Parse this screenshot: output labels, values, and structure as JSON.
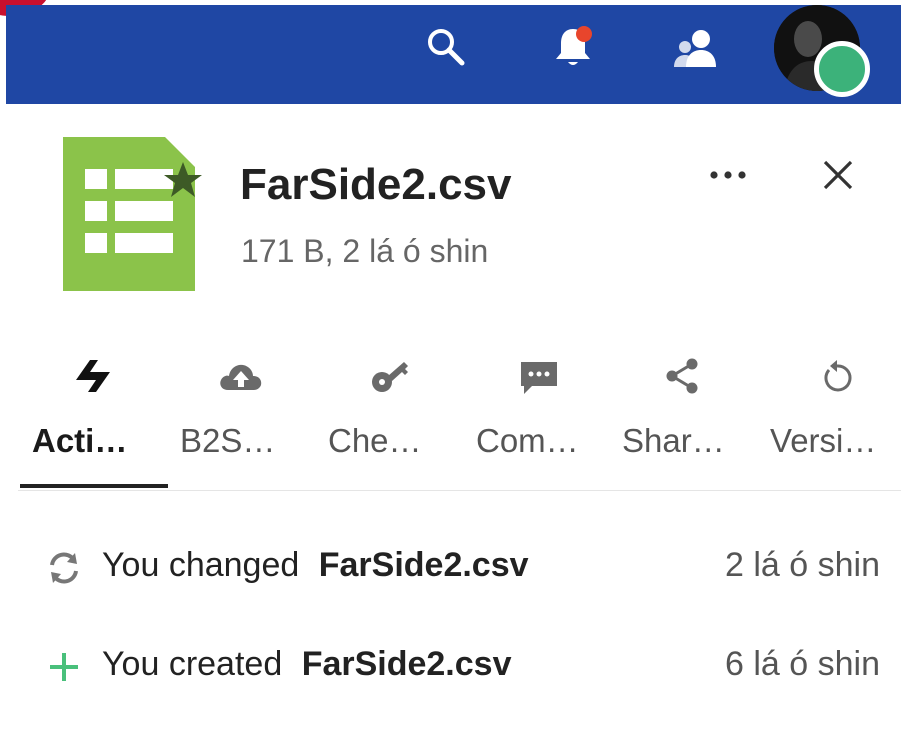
{
  "header": {
    "icons": [
      "search-icon",
      "notifications-icon",
      "contacts-icon"
    ],
    "avatar_status_color": "#3cb27a",
    "bar_color": "#1f47a4"
  },
  "sidebar": {
    "file": {
      "name": "FarSide2.csv",
      "meta": "171 B, 2 lá ó shin",
      "icon": "spreadsheet-icon",
      "icon_color": "#8bc34a",
      "favorite": true
    },
    "actions": {
      "more_label": "•••",
      "close_label": "✕"
    },
    "tabs": [
      {
        "label": "Acti…",
        "icon": "activity-icon",
        "active": true
      },
      {
        "label": "B2S…",
        "icon": "cloud-upload-icon",
        "active": false
      },
      {
        "label": "Che…",
        "icon": "key-icon",
        "active": false
      },
      {
        "label": "Com…",
        "icon": "comment-icon",
        "active": false
      },
      {
        "label": "Shar…",
        "icon": "share-icon",
        "active": false
      },
      {
        "label": "Versi…",
        "icon": "history-icon",
        "active": false
      }
    ],
    "activities": [
      {
        "prefix": "You changed",
        "file": "FarSide2.csv",
        "time": "2 lá ó shin",
        "icon": "change-icon"
      },
      {
        "prefix": "You created",
        "file": "FarSide2.csv",
        "time": "6 lá ó shin",
        "icon": "add-icon"
      }
    ]
  }
}
